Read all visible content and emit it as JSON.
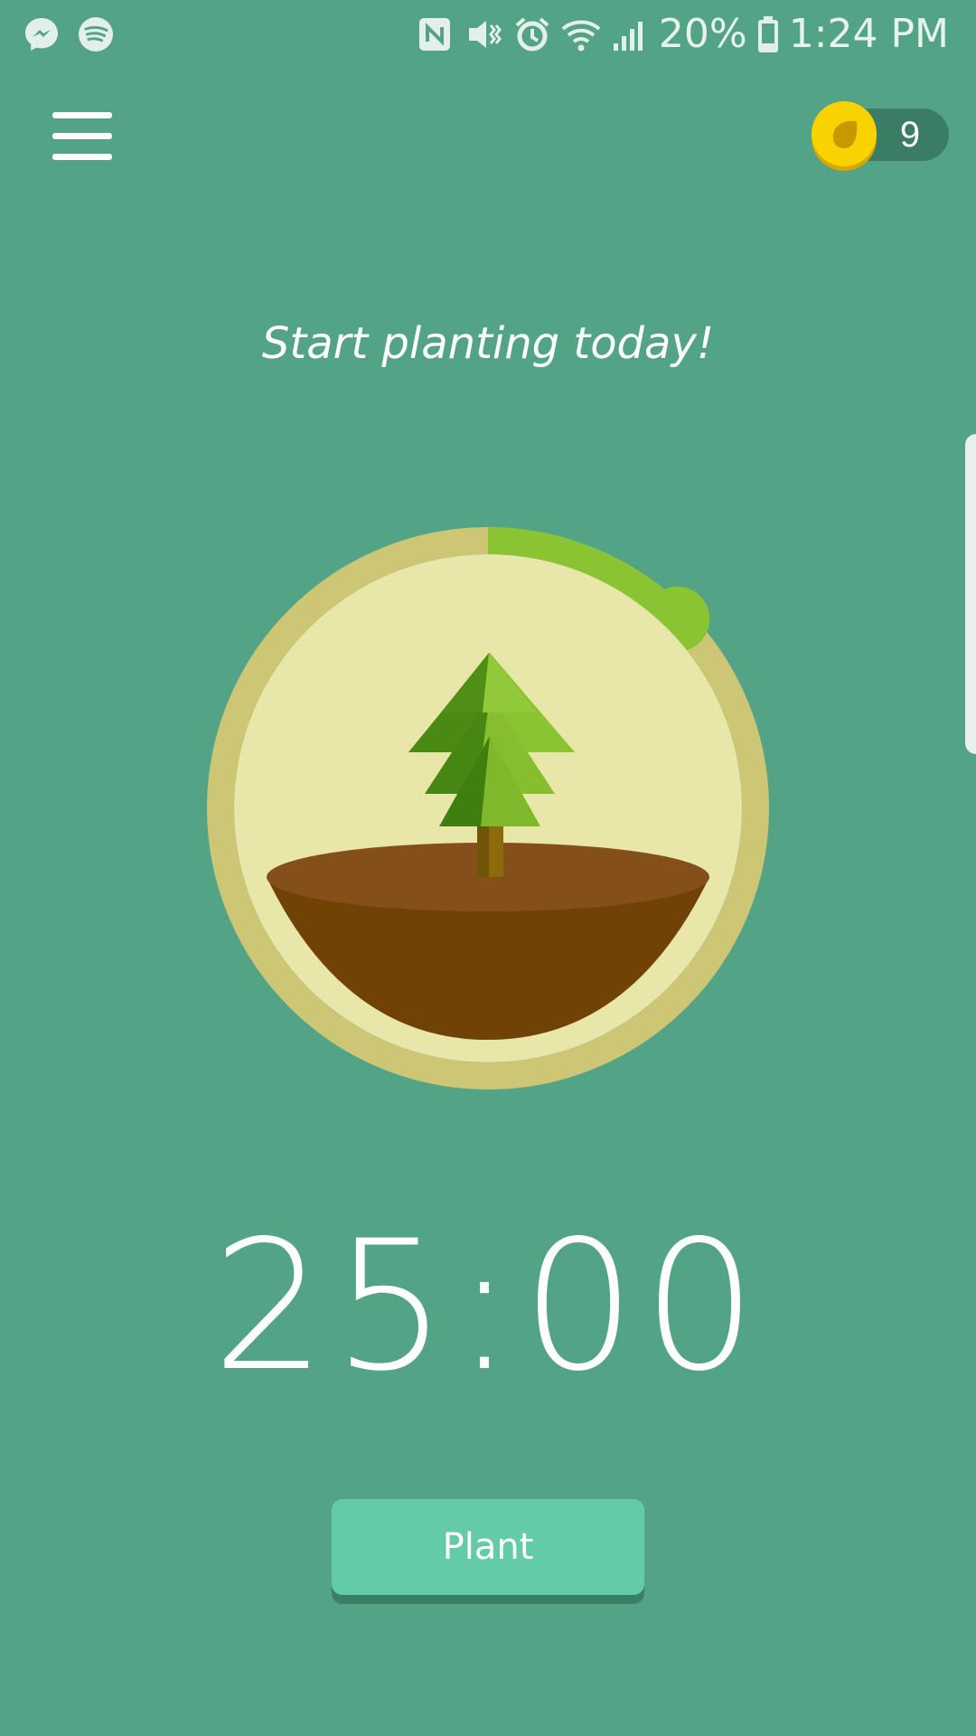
{
  "status_bar": {
    "left_icons": [
      "messenger-icon",
      "spotify-icon"
    ],
    "right_icons": [
      "nfc-icon",
      "vibrate-icon",
      "alarm-icon",
      "wifi-icon",
      "signal-icon"
    ],
    "battery_percent": "20%",
    "battery_icon": "battery-icon",
    "time": "1:24 PM"
  },
  "header": {
    "menu_icon": "hamburger-menu-icon",
    "coin_icon": "seed-coin-icon",
    "coin_count": "9"
  },
  "main": {
    "tagline": "Start planting today!",
    "timer": "25:00",
    "timer_progress": 0.125,
    "illustration": "pine-tree-in-soil"
  },
  "actions": {
    "plant_label": "Plant"
  },
  "colors": {
    "background": "#53a386",
    "ring_track": "#cdc674",
    "ring_progress": "#8bc432",
    "inner_circle": "#e8e6a8",
    "soil_top": "#844f18",
    "soil_body": "#714206",
    "coin": "#f8d300",
    "button": "#63cba6"
  }
}
